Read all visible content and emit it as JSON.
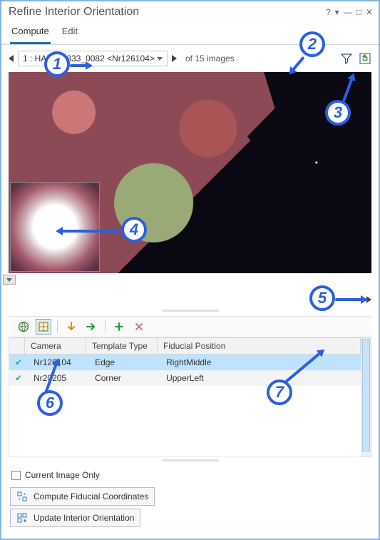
{
  "panel": {
    "title": "Refine Interior Orientation"
  },
  "tabs": {
    "compute": "Compute",
    "edit": "Edit"
  },
  "nav": {
    "selected_image": "1 : HAP83_333_0082 <Nr126104>",
    "of_images": "of 15 images"
  },
  "toolbar_icons": {
    "globe": "globe-icon",
    "target": "target-icon",
    "down": "arrow-down-icon",
    "right": "arrow-right-icon",
    "plus": "plus-icon",
    "delete": "delete-icon"
  },
  "table": {
    "headers": {
      "camera": "Camera",
      "template_type": "Template Type",
      "fiducial_position": "Fiducial Position"
    },
    "rows": [
      {
        "checked": true,
        "camera": "Nr126104",
        "template_type": "Edge",
        "fiducial_position": "RightMiddle",
        "selected": true
      },
      {
        "checked": true,
        "camera": "Nr20205",
        "template_type": "Corner",
        "fiducial_position": "UpperLeft",
        "selected": false
      }
    ]
  },
  "options": {
    "current_image_only": "Current Image Only"
  },
  "actions": {
    "compute_fiducial": "Compute Fiducial Coordinates",
    "update_interior": "Update Interior Orientation"
  },
  "callouts": {
    "c1": "1",
    "c2": "2",
    "c3": "3",
    "c4": "4",
    "c5": "5",
    "c6": "6",
    "c7": "7"
  }
}
